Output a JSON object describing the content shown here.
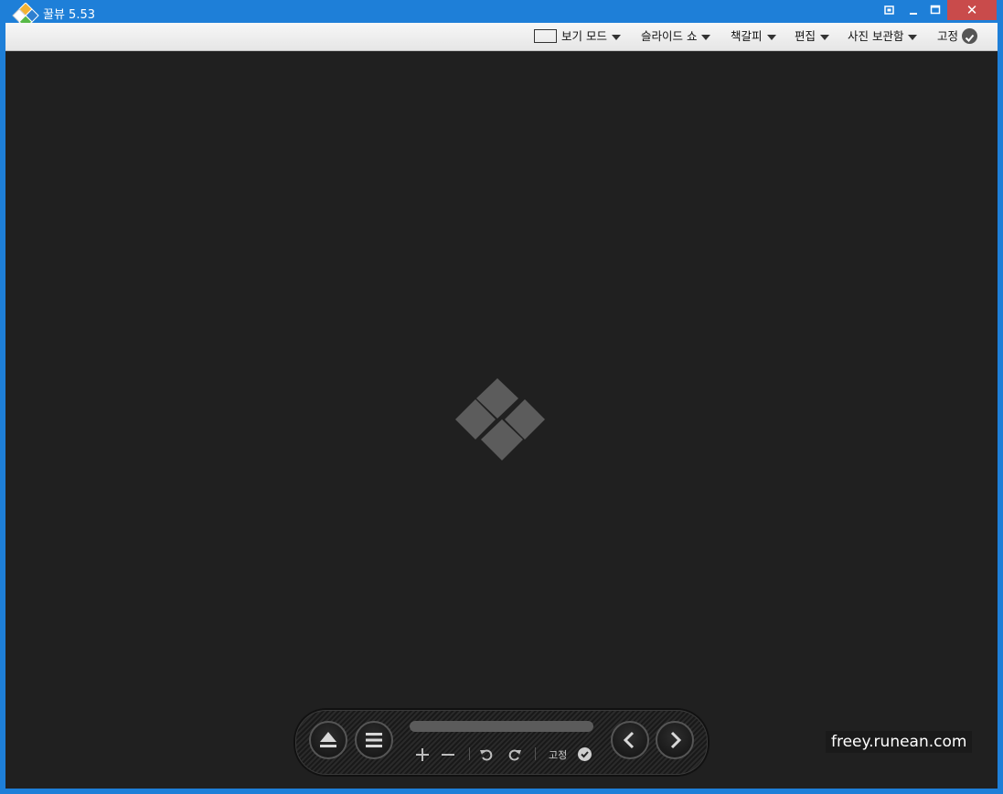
{
  "window": {
    "title": "꿀뷰 5.53",
    "close_symbol": "✕"
  },
  "menu": {
    "view_mode": "보기 모드",
    "slideshow": "슬라이드 쇼",
    "bookmark": "책갈피",
    "edit": "편집",
    "photo_storage": "사진 보관함",
    "pin": "고정"
  },
  "panel": {
    "pin_label": "고정",
    "progress": 0
  },
  "watermark": "freey.runean.com",
  "colors": {
    "titlebar": "#1e7fd8",
    "close": "#c94b4b",
    "viewer_bg": "#202020",
    "logo_gray": "#5c5c5c"
  }
}
